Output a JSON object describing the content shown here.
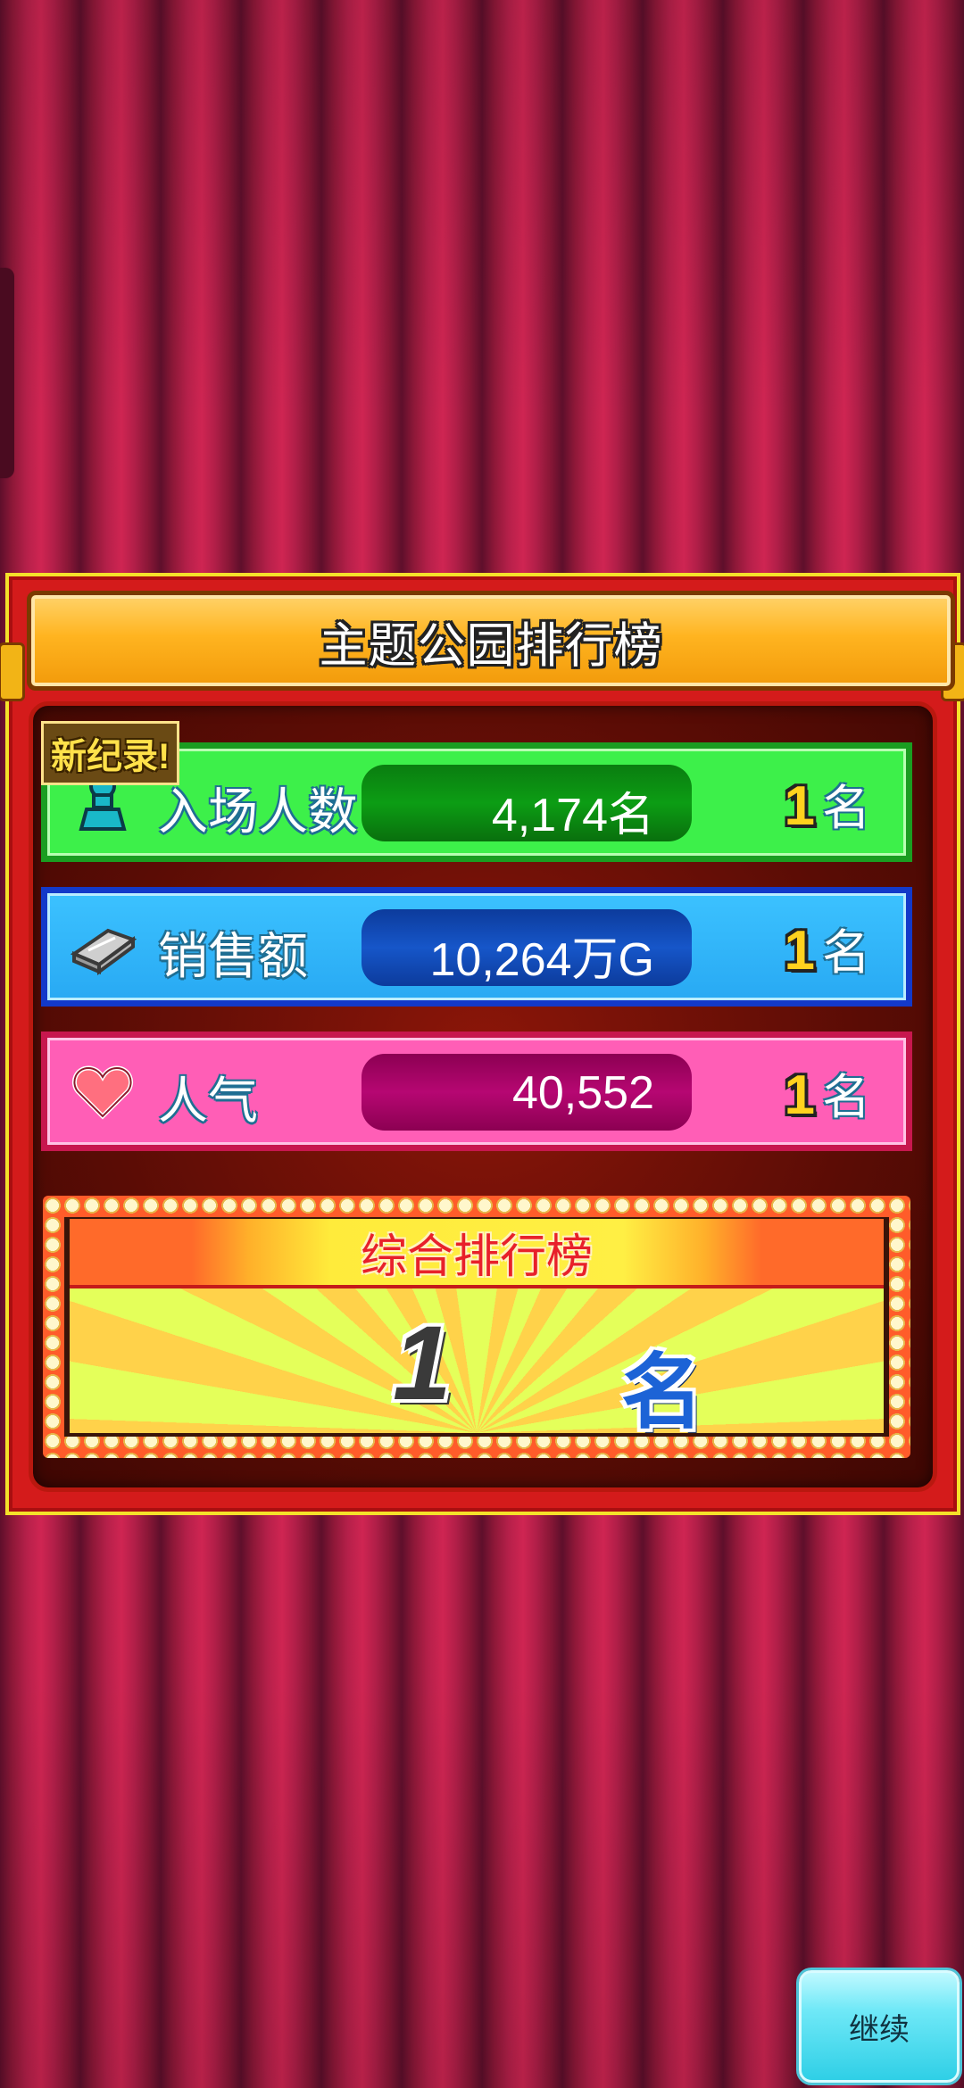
{
  "title": "主题公园排行榜",
  "new_record_badge": "新纪录!",
  "rows": [
    {
      "label": "入场人数",
      "value": "4,174名",
      "rank_number": "1",
      "rank_suffix": "名",
      "color": "#3df04a",
      "icon": "person-icon"
    },
    {
      "label": "销售额",
      "value": "10,264万G",
      "rank_number": "1",
      "rank_suffix": "名",
      "color": "#28a9f3",
      "icon": "money-stack-icon"
    },
    {
      "label": "人气",
      "value": "40,552",
      "rank_number": "1",
      "rank_suffix": "名",
      "color": "#ff5eb6",
      "icon": "heart-icon"
    }
  ],
  "overall": {
    "title": "综合排行榜",
    "rank_number": "1",
    "rank_suffix": "名"
  },
  "continue_button": "继续",
  "colors": {
    "board_red": "#d41b1b",
    "border_yellow": "#f5e12a",
    "title_orange": "#ffb420",
    "continue_cyan": "#2fcfe6"
  }
}
